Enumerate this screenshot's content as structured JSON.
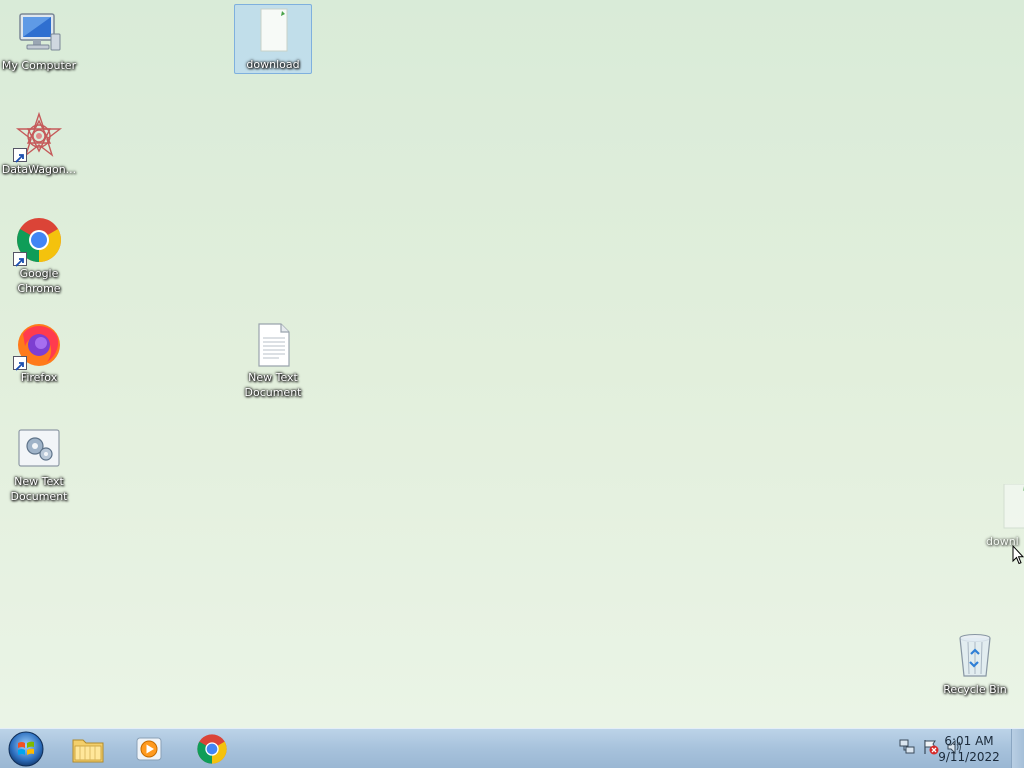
{
  "desktop": {
    "icons": [
      {
        "name": "my-computer",
        "label": "My Computer",
        "icon": "monitor-icon"
      },
      {
        "name": "datawagon",
        "label": "DataWagon...",
        "icon": "datawagon-star-icon"
      },
      {
        "name": "google-chrome",
        "label": "Google Chrome",
        "icon": "chrome-icon"
      },
      {
        "name": "firefox",
        "label": "Firefox",
        "icon": "firefox-icon"
      },
      {
        "name": "new-text-document-settings",
        "label": "New Text Document",
        "icon": "settings-file-icon"
      },
      {
        "name": "download",
        "label": "download",
        "icon": "file-icon"
      },
      {
        "name": "new-text-document",
        "label": "New Text Document",
        "icon": "text-file-icon"
      },
      {
        "name": "recycle-bin",
        "label": "Recycle Bin",
        "icon": "recycle-bin-icon"
      }
    ],
    "drag_ghost": {
      "label": "downl",
      "icon": "file-icon"
    }
  },
  "taskbar": {
    "start": {
      "icon": "windows-logo-icon"
    },
    "apps": [
      {
        "name": "file-explorer",
        "icon": "folder-icon"
      },
      {
        "name": "media-player",
        "icon": "media-player-icon"
      },
      {
        "name": "chrome",
        "icon": "chrome-icon"
      }
    ],
    "tray": [
      {
        "icon": "network-icon"
      },
      {
        "icon": "action-center-flag-icon"
      },
      {
        "icon": "volume-icon"
      }
    ],
    "clock": {
      "time": "6:01 AM",
      "date": "9/11/2022"
    }
  }
}
